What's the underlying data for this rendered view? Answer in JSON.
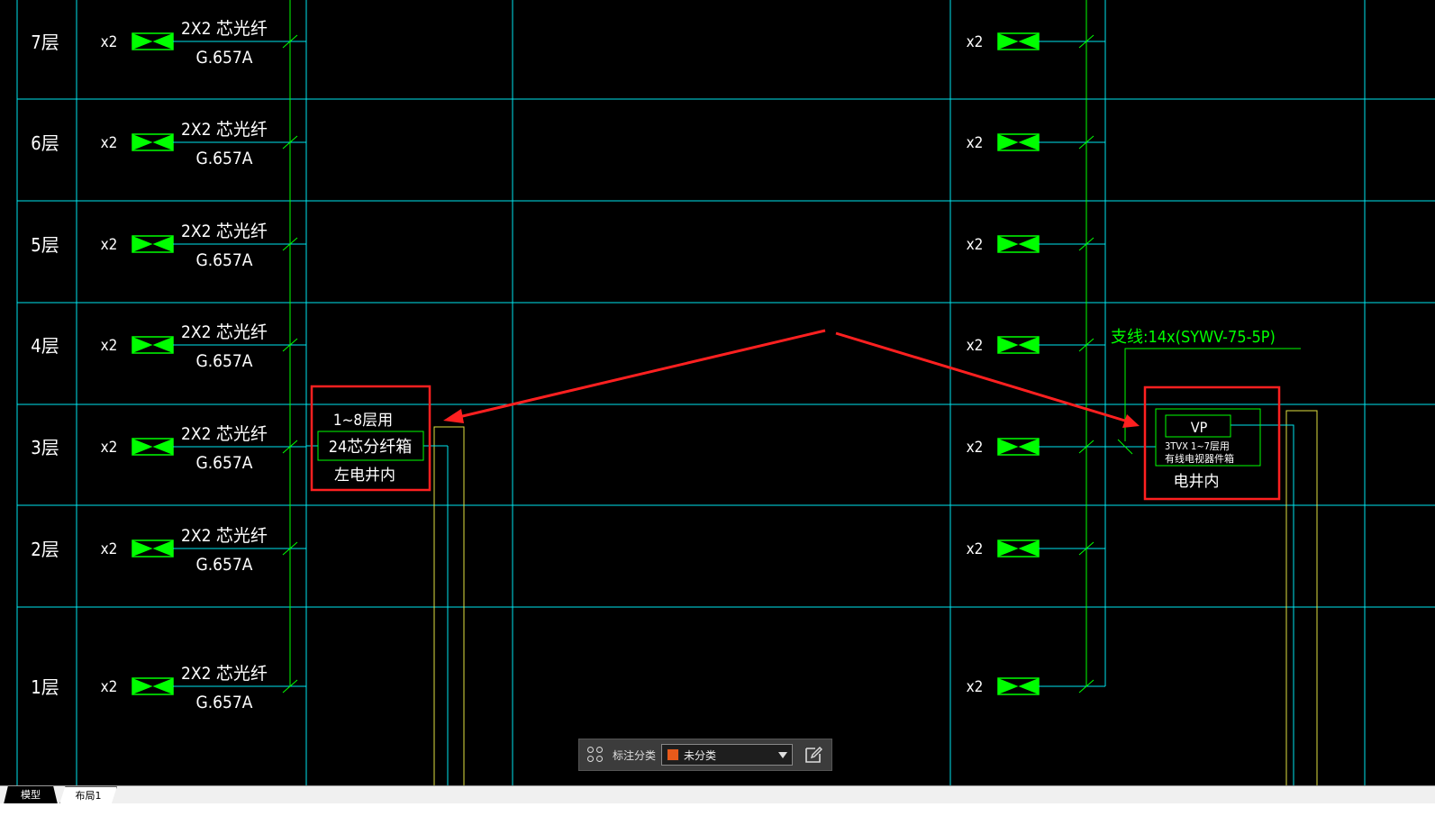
{
  "colors": {
    "grid": "#00e5ee",
    "symbol": "#00ff00",
    "text": "#ffffff",
    "riser": "#e0e040",
    "highlight": "#ff2020",
    "accent_swatch": "#e85a1a"
  },
  "floors": [
    {
      "label": "7层",
      "left_qty": "x2",
      "cable_line1": "2X2 芯光纤",
      "cable_line2": "G.657A",
      "right_qty": "x2"
    },
    {
      "label": "6层",
      "left_qty": "x2",
      "cable_line1": "2X2 芯光纤",
      "cable_line2": "G.657A",
      "right_qty": "x2"
    },
    {
      "label": "5层",
      "left_qty": "x2",
      "cable_line1": "2X2 芯光纤",
      "cable_line2": "G.657A",
      "right_qty": "x2"
    },
    {
      "label": "4层",
      "left_qty": "x2",
      "cable_line1": "2X2 芯光纤",
      "cable_line2": "G.657A",
      "right_qty": "x2"
    },
    {
      "label": "3层",
      "left_qty": "x2",
      "cable_line1": "2X2 芯光纤",
      "cable_line2": "G.657A",
      "right_qty": "x2"
    },
    {
      "label": "2层",
      "left_qty": "x2",
      "cable_line1": "2X2 芯光纤",
      "cable_line2": "G.657A",
      "right_qty": "x2"
    },
    {
      "label": "1层",
      "left_qty": "x2",
      "cable_line1": "2X2 芯光纤",
      "cable_line2": "G.657A",
      "right_qty": "x2"
    }
  ],
  "fiber_box": {
    "line1": "1~8层用",
    "line2": "24芯分纤箱",
    "line3": "左电井内"
  },
  "tv_box": {
    "tag": "VP",
    "line1": "3TVX 1~7层用",
    "line2": "有线电视器件箱",
    "line3": "电井内"
  },
  "branch_label": "支线:14x(SYWV-75-5P)",
  "toolbar": {
    "label": "标注分类",
    "selected": "未分类"
  },
  "tabs": [
    "模型",
    "布局1"
  ]
}
